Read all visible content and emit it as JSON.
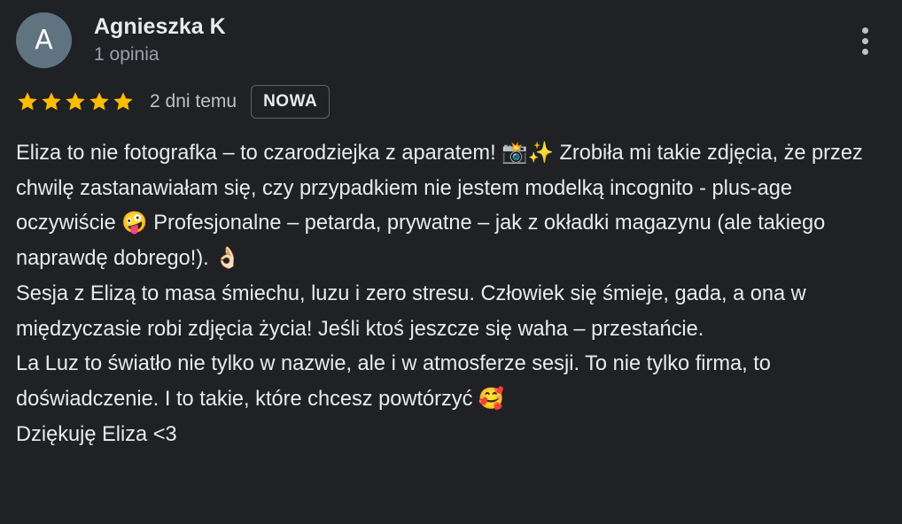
{
  "review": {
    "author": {
      "initial": "A",
      "name": "Agnieszka K",
      "review_count": "1 opinia",
      "avatar_color": "#5f7380"
    },
    "rating": {
      "stars": 5,
      "max": 5,
      "star_color": "#fbbc04"
    },
    "date": "2 dni temu",
    "badge": "NOWA",
    "paragraphs": [
      "Eliza to nie fotografka – to czarodziejka z aparatem! 📸✨ Zrobiła mi takie zdjęcia, że przez chwilę zastanawiałam się, czy przypadkiem nie jestem modelką incognito - plus-age oczywiście 🤪 Profesjonalne – petarda, prywatne – jak z okładki magazynu (ale takiego naprawdę dobrego!). 👌🏻",
      "Sesja z Elizą to masa śmiechu, luzu i zero stresu. Człowiek się śmieje, gada, a ona w międzyczasie robi zdjęcia życia! Jeśli ktoś jeszcze się waha – przestańcie.",
      "La Luz to światło nie tylko w nazwie, ale i w atmosferze sesji. To nie tylko firma, to doświadczenie. I to takie, które chcesz powtórzyć 🥰",
      "Dziękuję Eliza <3"
    ],
    "more_icon": "more-vert-icon"
  }
}
